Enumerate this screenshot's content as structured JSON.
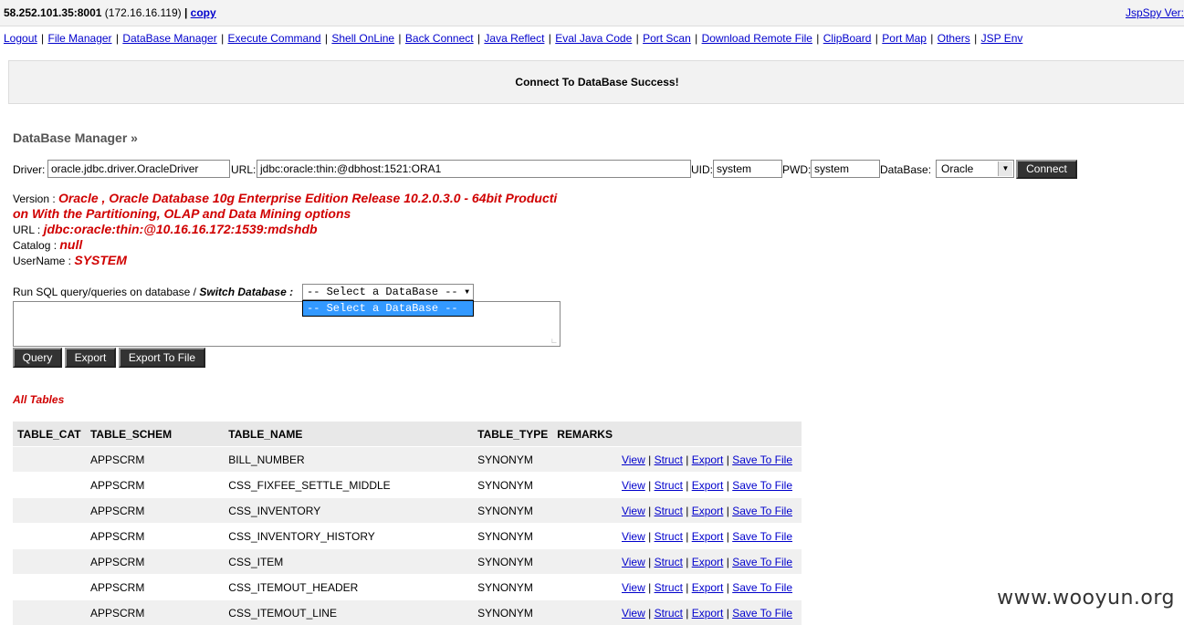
{
  "header": {
    "host": "58.252.101.35:8001",
    "host_ip": "(172.16.16.119)",
    "sep": "|",
    "copy_label": "copy",
    "version_label": "JspSpy Ver:"
  },
  "nav": [
    "Logout",
    "File Manager",
    "DataBase Manager",
    "Execute Command",
    "Shell OnLine",
    "Back Connect",
    "Java Reflect",
    "Eval Java Code",
    "Port Scan",
    "Download Remote File",
    "ClipBoard",
    "Port Map",
    "Others",
    "JSP Env"
  ],
  "message": "Connect To DataBase Success!",
  "section_title": "DataBase Manager »",
  "connection": {
    "driver_label": "Driver:",
    "driver_value": "oracle.jdbc.driver.OracleDriver",
    "url_label": "URL:",
    "url_value": "jdbc:oracle:thin:@dbhost:1521:ORA1",
    "uid_label": "UID:",
    "uid_value": "system",
    "pwd_label": "PWD:",
    "pwd_value": "system",
    "db_label": "DataBase:",
    "db_value": "Oracle",
    "connect_label": "Connect"
  },
  "info": {
    "version_label": "Version :",
    "version_value_1": "Oracle , Oracle Database 10g Enterprise Edition Release 10.2.0.3.0 - 64bit Producti",
    "version_value_2": "on With the Partitioning, OLAP and Data Mining options",
    "url_label": "URL :",
    "url_value": "jdbc:oracle:thin:@10.16.16.172:1539:mdshdb",
    "catalog_label": "Catalog :",
    "catalog_value": "null",
    "user_label": "UserName :",
    "user_value": "SYSTEM"
  },
  "sql": {
    "label": "Run SQL query/queries on database /",
    "switch_label": "Switch Database :",
    "select_value": "-- Select a DataBase --",
    "option_highlighted": "-- Select a DataBase --",
    "query_label": "Query",
    "export_label": "Export",
    "export_file_label": "Export To File"
  },
  "all_tables_label": "All Tables",
  "table": {
    "headers": [
      "TABLE_CAT",
      "TABLE_SCHEM",
      "TABLE_NAME",
      "TABLE_TYPE",
      "REMARKS"
    ],
    "actions": [
      "View",
      "Struct",
      "Export",
      "Save To File"
    ],
    "rows": [
      {
        "cat": "",
        "schem": "APPSCRM",
        "name": "BILL_NUMBER",
        "type": "SYNONYM",
        "remarks": ""
      },
      {
        "cat": "",
        "schem": "APPSCRM",
        "name": "CSS_FIXFEE_SETTLE_MIDDLE",
        "type": "SYNONYM",
        "remarks": ""
      },
      {
        "cat": "",
        "schem": "APPSCRM",
        "name": "CSS_INVENTORY",
        "type": "SYNONYM",
        "remarks": ""
      },
      {
        "cat": "",
        "schem": "APPSCRM",
        "name": "CSS_INVENTORY_HISTORY",
        "type": "SYNONYM",
        "remarks": ""
      },
      {
        "cat": "",
        "schem": "APPSCRM",
        "name": "CSS_ITEM",
        "type": "SYNONYM",
        "remarks": ""
      },
      {
        "cat": "",
        "schem": "APPSCRM",
        "name": "CSS_ITEMOUT_HEADER",
        "type": "SYNONYM",
        "remarks": ""
      },
      {
        "cat": "",
        "schem": "APPSCRM",
        "name": "CSS_ITEMOUT_LINE",
        "type": "SYNONYM",
        "remarks": ""
      }
    ]
  },
  "watermark": "www.wooyun.org"
}
